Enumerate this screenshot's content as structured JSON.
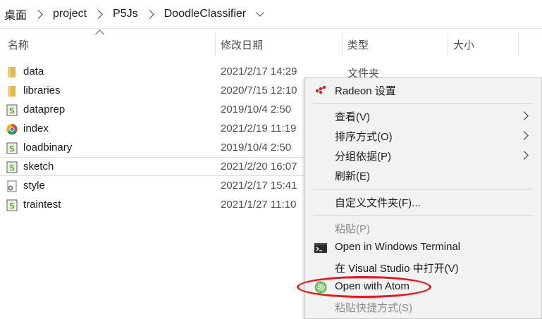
{
  "breadcrumb": [
    "桌面",
    "project",
    "P5Js",
    "DoodleClassifier"
  ],
  "columns": {
    "name": "名称",
    "modified": "修改日期",
    "type": "类型",
    "size": "大小"
  },
  "files": [
    {
      "name": "data",
      "date": "2021/2/17 14:29",
      "type": "文件夹",
      "icon": "folder-icon"
    },
    {
      "name": "libraries",
      "date": "2020/7/15 12:10",
      "type": "",
      "icon": "folder-icon"
    },
    {
      "name": "dataprep",
      "date": "2019/10/4 2:50",
      "type": "",
      "icon": "js-file-icon"
    },
    {
      "name": "index",
      "date": "2021/2/19 11:19",
      "type": "",
      "icon": "chrome-icon"
    },
    {
      "name": "loadbinary",
      "date": "2019/10/4 2:50",
      "type": "",
      "icon": "js-file-icon"
    },
    {
      "name": "sketch",
      "date": "2021/2/20 16:07",
      "type": "",
      "icon": "js-file-icon"
    },
    {
      "name": "style",
      "date": "2021/2/17 15:41",
      "type": "",
      "icon": "css-file-icon"
    },
    {
      "name": "traintest",
      "date": "2021/1/27 11:10",
      "type": "",
      "icon": "js-file-icon"
    }
  ],
  "context_menu": {
    "radeon": "Radeon 设置",
    "view": "查看(V)",
    "sort": "排序方式(O)",
    "group": "分组依据(P)",
    "refresh": "刷新(E)",
    "customize": "自定义文件夹(F)...",
    "paste": "粘贴(P)",
    "terminal": "Open in Windows Terminal",
    "vscode": "在 Visual Studio 中打开(V)",
    "atom": "Open with Atom",
    "paste_shortcut": "粘贴快捷方式(S)"
  },
  "colors": {
    "highlight_ring": "#e8191c",
    "folder": "#e8b74a",
    "radeon": "#d52027",
    "atom": "#66b35e"
  }
}
